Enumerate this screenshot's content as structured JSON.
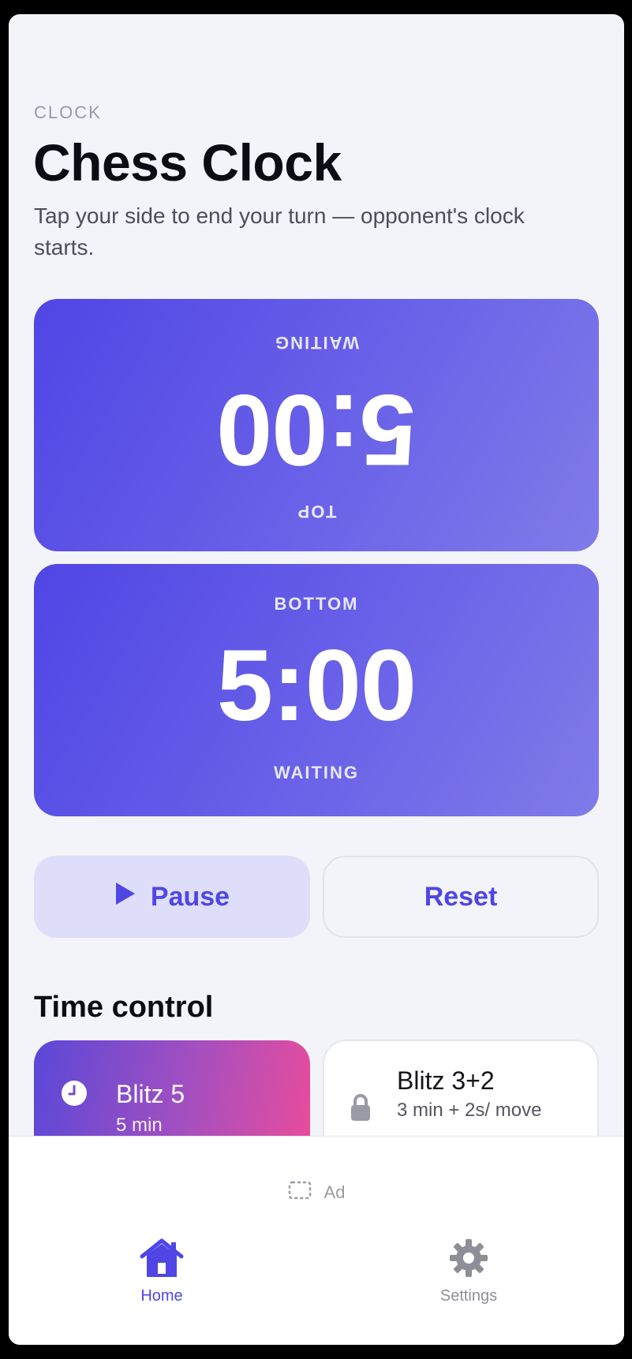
{
  "header": {
    "eyebrow": "CLOCK",
    "title": "Chess Clock",
    "subtitle": "Tap your side to end your turn — opponent's clock starts."
  },
  "clocks": {
    "top": {
      "label": "TOP",
      "time": "5:00",
      "state": "WAITING"
    },
    "bottom": {
      "label": "BOTTOM",
      "time": "5:00",
      "state": "WAITING"
    }
  },
  "controls": {
    "pause_label": "Pause",
    "reset_label": "Reset"
  },
  "time_control": {
    "heading": "Time control",
    "options": [
      {
        "name": "Blitz 5",
        "desc": "5 min",
        "icon": "clock-icon",
        "selected": true
      },
      {
        "name": "Blitz 3+2",
        "desc": "3 min + 2s/ move",
        "icon": "lock-icon",
        "selected": false
      }
    ]
  },
  "ad": {
    "label": "Ad",
    "icon": "ad-placeholder-icon"
  },
  "tabs": [
    {
      "label": "Home",
      "icon": "home-icon",
      "active": true
    },
    {
      "label": "Settings",
      "icon": "gear-icon",
      "active": false
    }
  ],
  "colors": {
    "accent": "#4f46e5",
    "background": "#f3f3fa",
    "gradient_pink": "#ea4c9b"
  }
}
